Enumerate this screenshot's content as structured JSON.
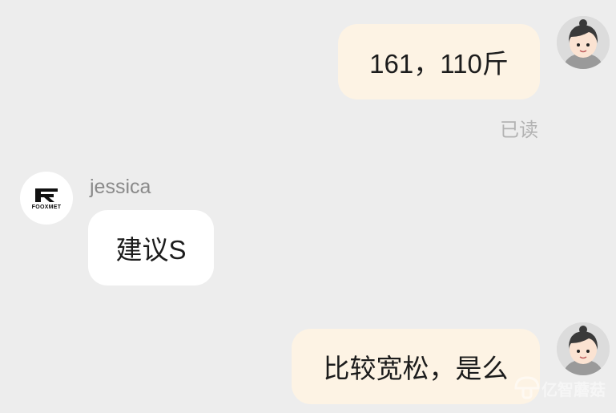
{
  "messages": [
    {
      "side": "out",
      "text": "161，110斤",
      "status": "已读"
    },
    {
      "side": "in",
      "sender": "jessica",
      "text": "建议S",
      "avatar_logo": "FOOXMET"
    },
    {
      "side": "out",
      "text": "比较宽松，是么"
    }
  ],
  "watermark": {
    "text": "亿智蘑菇",
    "icon": "mushroom-logo-icon"
  },
  "colors": {
    "background": "#ededed",
    "outgoing_bubble": "#fdf3e4",
    "incoming_bubble": "#ffffff",
    "read_status": "#b3b3b3"
  }
}
